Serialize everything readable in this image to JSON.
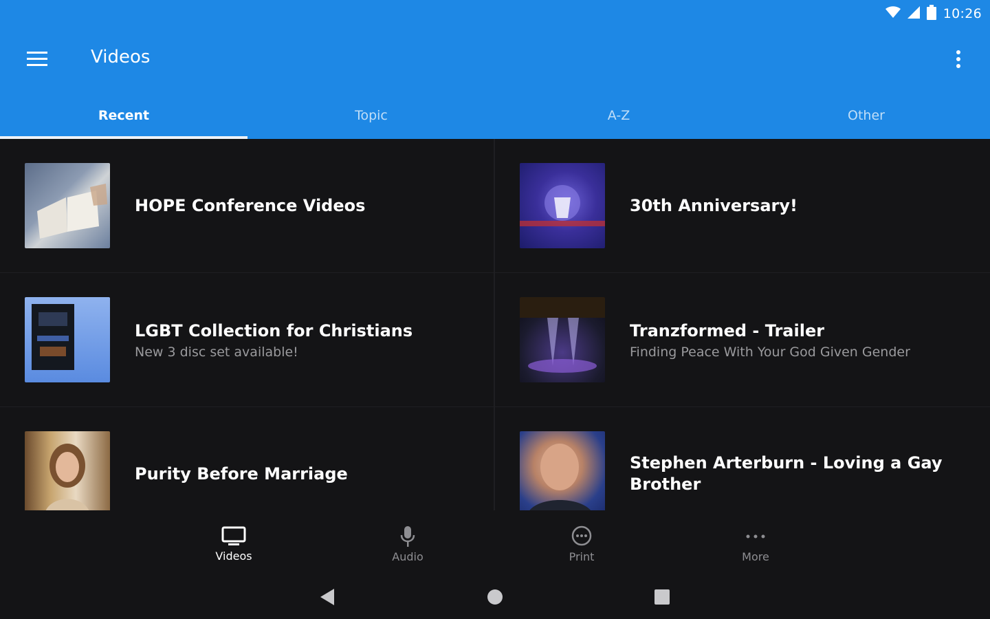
{
  "status": {
    "time": "10:26"
  },
  "toolbar": {
    "title": "Videos"
  },
  "tabs": [
    {
      "label": "Recent",
      "active": true
    },
    {
      "label": "Topic",
      "active": false
    },
    {
      "label": "A-Z",
      "active": false
    },
    {
      "label": "Other",
      "active": false
    }
  ],
  "items": [
    {
      "title": "HOPE Conference Videos",
      "subtitle": "",
      "thumb_icon": "bible-image"
    },
    {
      "title": "30th Anniversary!",
      "subtitle": "",
      "thumb_icon": "anniversary-image"
    },
    {
      "title": "LGBT Collection for Christians",
      "subtitle": "New 3 disc set available!",
      "thumb_icon": "dvd-box-image"
    },
    {
      "title": "Tranzformed - Trailer",
      "subtitle": "Finding Peace With Your God Given Gender",
      "thumb_icon": "tranzformed-image"
    },
    {
      "title": "Purity Before Marriage",
      "subtitle": "",
      "thumb_icon": "woman-portrait-image"
    },
    {
      "title": "Stephen Arterburn - Loving a Gay Brother",
      "subtitle": "",
      "thumb_icon": "man-portrait-image"
    }
  ],
  "bottom_nav": [
    {
      "label": "Videos",
      "icon": "tv-icon",
      "active": true
    },
    {
      "label": "Audio",
      "icon": "microphone-icon",
      "active": false
    },
    {
      "label": "Print",
      "icon": "chat-bubble-icon",
      "active": false
    },
    {
      "label": "More",
      "icon": "more-dots-icon",
      "active": false
    }
  ],
  "colors": {
    "primary": "#1e88e5",
    "background": "#141416",
    "subtitle": "#9a9a9d"
  }
}
